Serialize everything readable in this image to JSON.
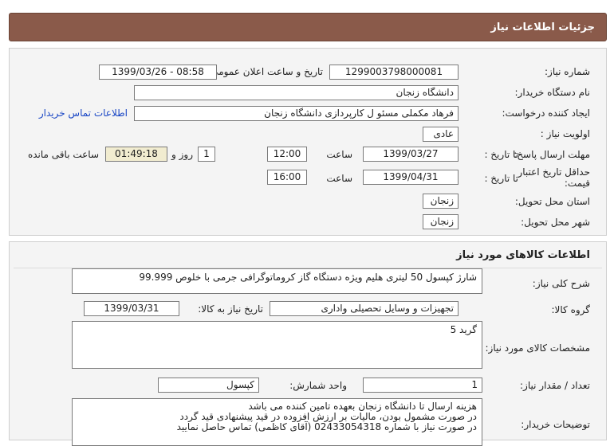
{
  "header": {
    "title": "جزئیات اطلاعات نیاز"
  },
  "info": {
    "need_number_label": "شماره نیاز:",
    "need_number": "1299003798000081",
    "announce_label": "تاریخ و ساعت اعلان عمومی:",
    "announce_value": "1399/03/26 - 08:58",
    "buyer_org_label": "نام دستگاه خریدار:",
    "buyer_org": "دانشگاه زنجان",
    "creator_label": "ایجاد کننده درخواست:",
    "creator": "فرهاد مکملی مسئو ل کارپردازی دانشگاه زنجان",
    "contact_link": "اطلاعات تماس خریدار",
    "priority_label": "اولویت نیاز :",
    "priority": "عادی",
    "deadline_label": "مهلت ارسال پاسخ:",
    "to_date_label": "تا تاریخ :",
    "deadline_date": "1399/03/27",
    "time_label": "ساعت",
    "deadline_time": "12:00",
    "days_value": "1",
    "days_label": "روز و",
    "remaining_time": "01:49:18",
    "remaining_label": "ساعت باقی مانده",
    "validity_label_1": "حداقل تاریخ اعتبار",
    "validity_label_2": "قیمت:",
    "validity_date": "1399/04/31",
    "validity_time": "16:00",
    "province_label": "استان محل تحویل:",
    "province": "زنجان",
    "city_label": "شهر محل تحویل:",
    "city": "زنجان"
  },
  "goods": {
    "title": "اطلاعات کالاهای مورد نیاز",
    "summary_label": "شرح کلی نیاز:",
    "summary": "شارژ کپسول 50 لیتری هلیم ویژه دستگاه گاز کروماتوگرافی جرمی با خلوص 99.999",
    "group_label": "گروه کالا:",
    "group": "تجهیزات و وسایل تحصیلی واداری",
    "need_date_label": "تاریخ نیاز به کالا:",
    "need_date": "1399/03/31",
    "specs_label": "مشخصات کالای مورد نیاز:",
    "specs": "گرید 5",
    "qty_label": "تعداد / مقدار نیاز:",
    "qty": "1",
    "unit_label": "واحد شمارش:",
    "unit": "کپسول",
    "notes_label": "توضیحات خریدار:",
    "notes": [
      "هزینه ارسال تا دانشگاه زنجان بعهده تامین کننده می باشد",
      "در صورت مشمول بودن، مالیات بر ارزش افزوده در قید پیشنهادی قید گردد",
      "در صورت نیاز با شماره 02433054318 (آقای کاظمی) تماس حاصل نمایید"
    ]
  }
}
